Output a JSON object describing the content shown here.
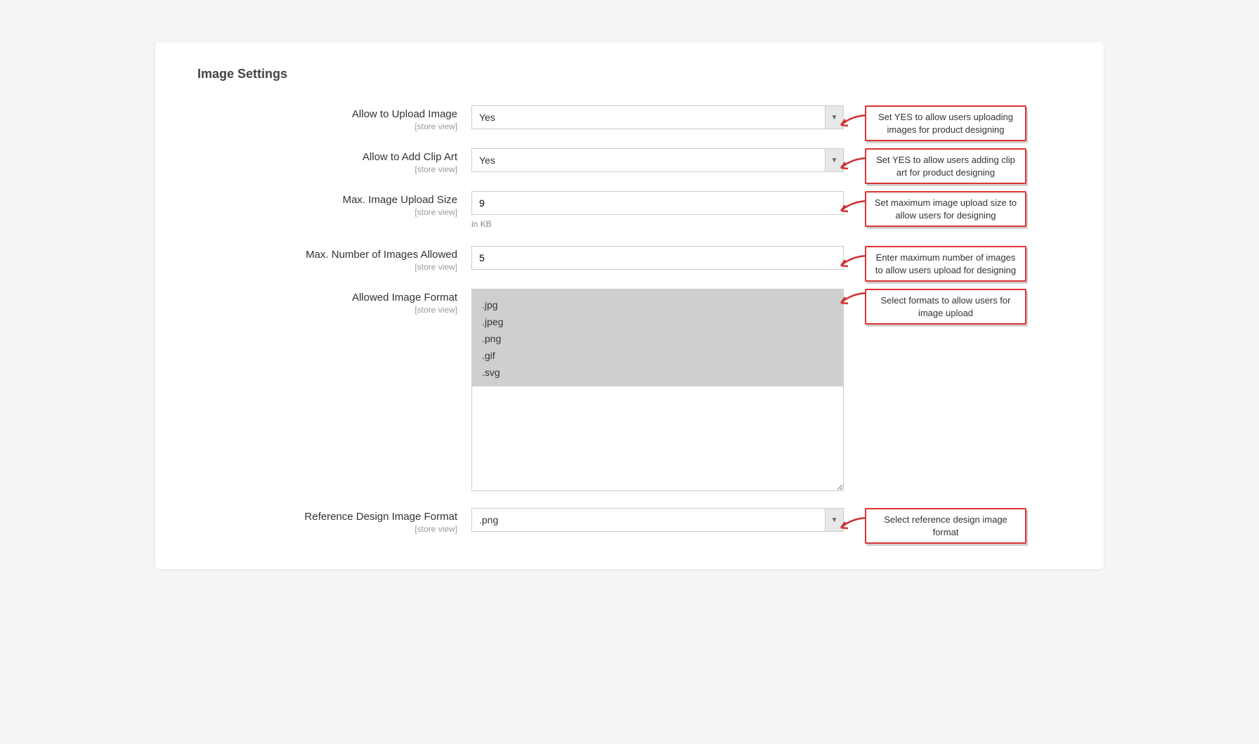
{
  "section_title": "Image Settings",
  "scope_text": "[store view]",
  "allow_upload": {
    "label": "Allow to Upload Image",
    "value": "Yes",
    "hint": "Set YES to allow users uploading images for product designing"
  },
  "allow_clipart": {
    "label": "Allow to Add Clip Art",
    "value": "Yes",
    "hint": "Set YES to allow users adding clip art for product designing"
  },
  "max_size": {
    "label": "Max. Image Upload Size",
    "value": "9",
    "note": "in KB",
    "hint": "Set maximum image upload size to allow users for designing"
  },
  "max_count": {
    "label": "Max. Number of Images Allowed",
    "value": "5",
    "hint": "Enter maximum number of images to allow users upload for designing"
  },
  "allowed_format": {
    "label": "Allowed Image Format",
    "options": [
      ".jpg",
      ".jpeg",
      ".png",
      ".gif",
      ".svg"
    ],
    "hint": "Select formats to allow users for image upload"
  },
  "ref_format": {
    "label": "Reference Design Image Format",
    "value": ".png",
    "hint": "Select reference design image format"
  }
}
